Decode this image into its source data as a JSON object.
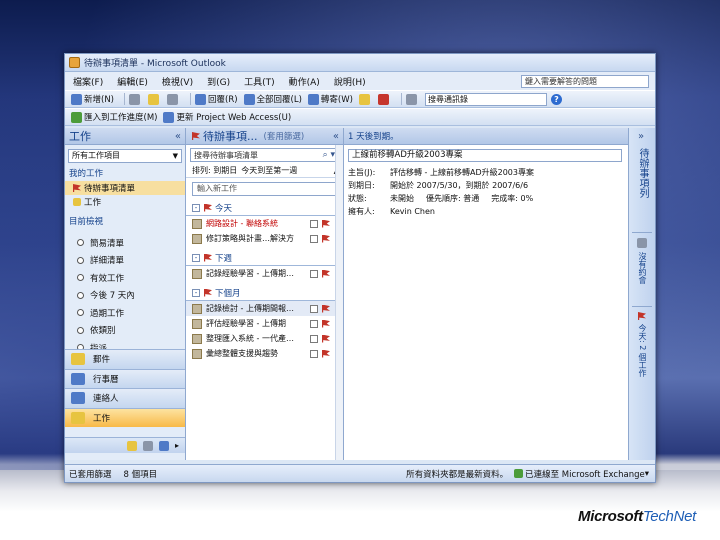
{
  "window": {
    "title": "待辦事項清單 - Microsoft Outlook"
  },
  "menu": {
    "items": [
      "檔案(F)",
      "編輯(E)",
      "檢視(V)",
      "到(G)",
      "工具(T)",
      "動作(A)",
      "說明(H)"
    ],
    "help_box": "鍵入需要解答的問題"
  },
  "toolbar1": {
    "new_label": "新增(N)",
    "reply_label": "回覆(R)",
    "reply_all_label": "全部回覆(L)",
    "forward_label": "轉寄(W)",
    "find_label": "尋找",
    "search_value": "搜尋通訊錄"
  },
  "toolbar2": {
    "import_label": "匯入到工作進度(M)",
    "update_label": "更新 Project Web Access(U)"
  },
  "nav": {
    "header": "工作",
    "collapse": "«",
    "dropdown": "所有工作項目",
    "section_my_tasks": "我的工作",
    "tasks": [
      {
        "label": "待辦事項清單",
        "selected": true
      },
      {
        "label": "工作",
        "selected": false
      }
    ],
    "section_views": "目前檢視",
    "views": [
      "簡易清單",
      "詳細清單",
      "有效工作",
      "今後 7 天內",
      "過期工作",
      "依類別",
      "指派"
    ],
    "buttons": [
      "郵件",
      "行事曆",
      "連絡人",
      "工作"
    ]
  },
  "task_list": {
    "header": "待辦事項...",
    "subheader": "(套用篩選)",
    "collapse": "«",
    "search_placeholder": "搜尋待辦事項清單",
    "sort_label": "排列: 到期日",
    "sort_value": "今天到至第一週",
    "new_task_placeholder": "輸入新工作",
    "groups": [
      {
        "name": "今天",
        "items": [
          {
            "text": "網路設計 - 聯絡系統",
            "red": true
          },
          {
            "text": "修訂策略與計畫…解決方",
            "red": false
          }
        ]
      },
      {
        "name": "下週",
        "items": [
          {
            "text": "記錄經驗學習 - 上傳期…",
            "red": false
          }
        ]
      },
      {
        "name": "下個月",
        "items": [
          {
            "text": "記錄檢討 - 上傳期間報…",
            "red": false,
            "highlight": true
          },
          {
            "text": "評估經驗學習 - 上傳期",
            "red": false
          },
          {
            "text": "整理匯入系統 - 一代產…",
            "red": false
          },
          {
            "text": "彙總整體支援與趨勢",
            "red": false
          }
        ]
      }
    ]
  },
  "reader": {
    "header": "1 天後到期。",
    "subject": "上線前移轉AD升級2003專案",
    "rows": [
      {
        "label": "主旨(J):",
        "values": [
          "評估移轉 - 上線前移轉AD升級2003專案"
        ]
      },
      {
        "label": "到期日:",
        "values": [
          "開始於 2007/5/30，到期於 2007/6/6"
        ]
      },
      {
        "label": "狀態:",
        "values": [
          "未開始",
          "優先順序: 普通",
          "完成率: 0%"
        ]
      },
      {
        "label": "擁有人:",
        "values": [
          "Kevin Chen"
        ]
      }
    ]
  },
  "todo_bar": {
    "chevron": "»",
    "title": "待辦事項列",
    "calendar": "沒有約會",
    "tasks": "今天: 2 個工作"
  },
  "status": {
    "filter": "已套用篩選",
    "count": "8 個項目",
    "folders": "所有資料夾都是最新資料。",
    "connection": "已連線至 Microsoft Exchange"
  },
  "brand": {
    "ms": "Microsoft",
    "tn": "TechNet"
  }
}
